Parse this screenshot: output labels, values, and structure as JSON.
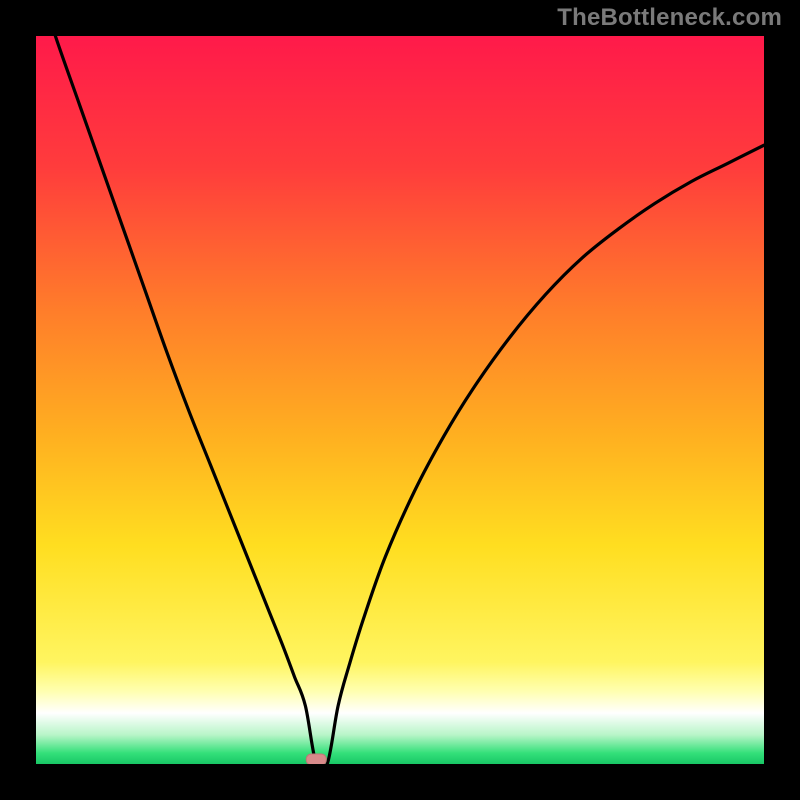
{
  "watermark": "TheBottleneck.com",
  "colors": {
    "frame": "#000000",
    "watermark": "#7a7a7a",
    "curve": "#000000",
    "marker_fill": "#d88a8a",
    "marker_stroke": "#c07777",
    "gradient_stops": [
      {
        "offset": 0.0,
        "color": "#ff1a4a"
      },
      {
        "offset": 0.18,
        "color": "#ff3c3c"
      },
      {
        "offset": 0.38,
        "color": "#ff7e2a"
      },
      {
        "offset": 0.55,
        "color": "#ffb020"
      },
      {
        "offset": 0.7,
        "color": "#ffde20"
      },
      {
        "offset": 0.86,
        "color": "#fff560"
      },
      {
        "offset": 0.9,
        "color": "#ffffb0"
      },
      {
        "offset": 0.93,
        "color": "#ffffff"
      },
      {
        "offset": 0.96,
        "color": "#b8f5c8"
      },
      {
        "offset": 0.985,
        "color": "#34e07a"
      },
      {
        "offset": 1.0,
        "color": "#18c765"
      }
    ]
  },
  "chart_data": {
    "type": "line",
    "title": "",
    "xlabel": "",
    "ylabel": "",
    "xlim": [
      0,
      100
    ],
    "ylim": [
      0,
      100
    ],
    "grid": false,
    "legend": false,
    "axes_visible": false,
    "marker": {
      "x": 38.5,
      "y": 0,
      "shape": "rounded-rect"
    },
    "series": [
      {
        "name": "bottleneck-curve",
        "x": [
          0,
          3,
          6,
          9,
          12,
          15,
          18,
          21,
          24,
          27,
          30,
          32,
          34,
          35.5,
          37,
          38.5,
          40,
          41.5,
          43,
          45,
          48,
          52,
          56,
          60,
          65,
          70,
          75,
          80,
          85,
          90,
          95,
          100
        ],
        "y": [
          108,
          99,
          90.5,
          82,
          73.5,
          65,
          56.5,
          48.5,
          41,
          33.5,
          26,
          21,
          16,
          12,
          8,
          0,
          0,
          8,
          13.5,
          20,
          28.5,
          37.5,
          45,
          51.5,
          58.5,
          64.5,
          69.5,
          73.5,
          77,
          80,
          82.5,
          85
        ]
      }
    ]
  }
}
